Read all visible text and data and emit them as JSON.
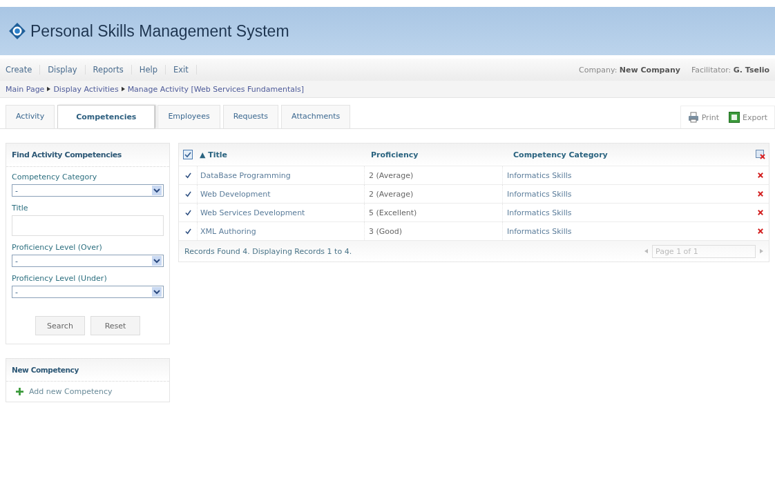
{
  "header": {
    "title": "Personal Skills Management System"
  },
  "menu": [
    "Create",
    "Display",
    "Reports",
    "Help",
    "Exit"
  ],
  "company": {
    "label": "Company:",
    "value": "New Company"
  },
  "facilitator": {
    "label": "Facilitator:",
    "value": "G. Tselio"
  },
  "breadcrumb": [
    "Main Page",
    "Display Activities",
    "Manage Activity [Web Services Fundamentals]"
  ],
  "tabs": [
    {
      "label": "Activity",
      "selected": false
    },
    {
      "label": "Competencies",
      "selected": true
    },
    {
      "label": "Employees",
      "selected": false
    },
    {
      "label": "Requests",
      "selected": false
    },
    {
      "label": "Attachments",
      "selected": false
    }
  ],
  "actions": [
    {
      "label": "Print",
      "kind": "print"
    },
    {
      "label": "Export",
      "kind": "export"
    }
  ],
  "search_panel": {
    "title": "Find Activity Competencies",
    "fields": [
      {
        "label": "Competency Category",
        "kind": "select",
        "value": "-"
      },
      {
        "label": "Title",
        "kind": "text"
      },
      {
        "label": "Proficiency Level (Over)",
        "kind": "select",
        "value": "-"
      },
      {
        "label": "Proficiency Level (Under)",
        "kind": "select",
        "value": "-"
      }
    ],
    "buttons": [
      "Search",
      "Reset"
    ]
  },
  "new_panel": {
    "title": "New Competency",
    "link": "Add new Competency"
  },
  "table": {
    "sort_mark": "▲",
    "columns": [
      "Title",
      "Proficiency",
      "Competency Category"
    ],
    "rows": [
      {
        "title": "DataBase Programming",
        "proficiency": "2 (Average)",
        "category": "Informatics Skills"
      },
      {
        "title": "Web Development",
        "proficiency": "2 (Average)",
        "category": "Informatics Skills"
      },
      {
        "title": "Web Services Development",
        "proficiency": "5 (Excellent)",
        "category": "Informatics Skills"
      },
      {
        "title": "XML Authoring",
        "proficiency": "3 (Good)",
        "category": "Informatics Skills"
      }
    ],
    "footer": "Records Found 4. Displaying Records 1 to 4.",
    "pager": "Page 1 of 1"
  }
}
